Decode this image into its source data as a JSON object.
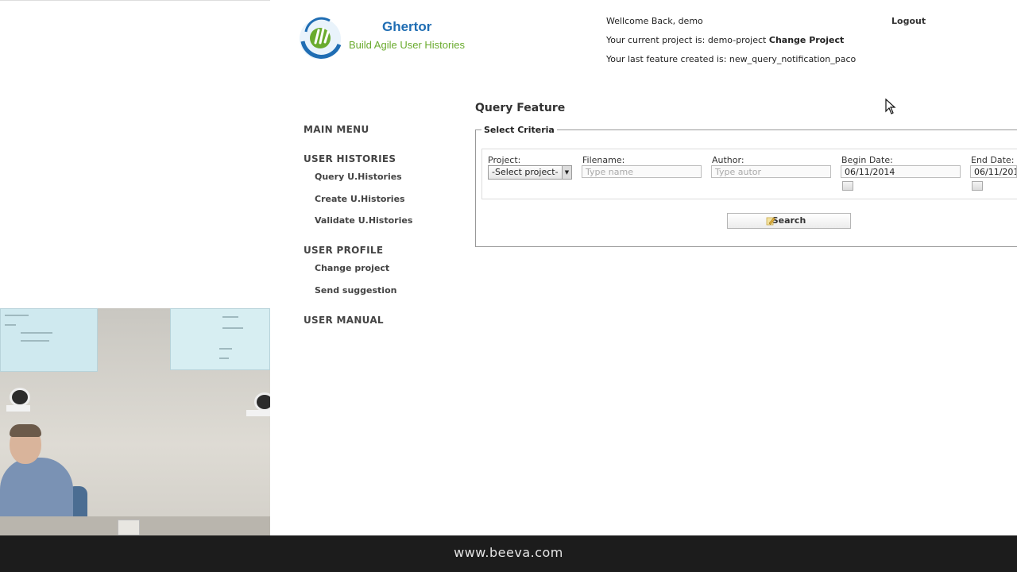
{
  "app": {
    "brand_title": "Ghertor",
    "brand_subtitle": "Build Agile User Histories"
  },
  "header": {
    "welcome": "Wellcome Back, demo",
    "project_prefix": "Your current project is: demo-project",
    "change_project_link": "Change Project",
    "last_feature": "Your last feature created is: new_query_notification_paco",
    "logout": "Logout"
  },
  "menu": {
    "main": "MAIN MENU",
    "user_histories": "USER HISTORIES",
    "query": "Query U.Histories",
    "create": "Create U.Histories",
    "validate": "Validate U.Histories",
    "user_profile": "USER PROFILE",
    "change_project": "Change project",
    "send_suggestion": "Send suggestion",
    "user_manual": "USER MANUAL"
  },
  "query": {
    "title": "Query Feature",
    "legend": "Select Criteria",
    "project_label": "Project:",
    "project_value": "-Select project-",
    "filename_label": "Filename:",
    "filename_placeholder": "Type name",
    "author_label": "Author:",
    "author_placeholder": "Type autor",
    "begin_label": "Begin Date:",
    "begin_value": "06/11/2014",
    "end_label": "End Date:",
    "end_value": "06/11/201",
    "search_button": "Search"
  },
  "footer": {
    "url": "www.beeva.com"
  },
  "colors": {
    "brand_blue": "#1f6db3",
    "brand_green": "#6aab2e",
    "footer_bg": "#1c1c1c"
  }
}
